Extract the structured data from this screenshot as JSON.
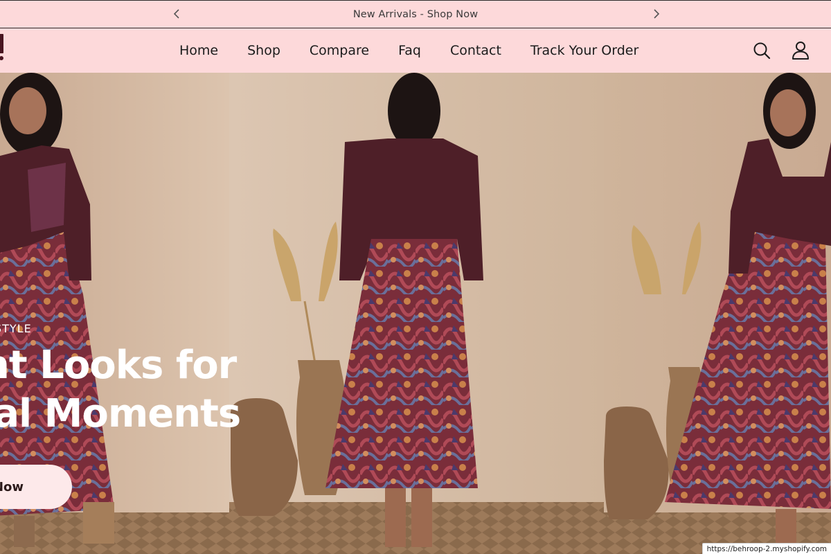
{
  "announcement": {
    "text": "New Arrivals - Shop Now",
    "prev_icon": "chevron-left-icon",
    "next_icon": "chevron-right-icon"
  },
  "header": {
    "nav": [
      {
        "label": "Home"
      },
      {
        "label": "Shop"
      },
      {
        "label": "Compare"
      },
      {
        "label": "Faq"
      },
      {
        "label": "Contact"
      },
      {
        "label": "Track Your Order"
      }
    ],
    "search_icon": "search-icon",
    "account_icon": "user-icon"
  },
  "hero": {
    "eyebrow": "STYLE",
    "line1": "nt Looks for",
    "line2": "ial Moments",
    "button_label": "Now",
    "images": [
      {
        "name": "model-front-left"
      },
      {
        "name": "model-back-center"
      },
      {
        "name": "model-front-right"
      }
    ]
  },
  "status_bar": {
    "url": "https://behroop-2.myshopify.com"
  },
  "colors": {
    "page_pink": "#fdd9da",
    "garment_plum": "#4e1f28",
    "wall_beige": "#d6bfa6",
    "hero_text": "#ffffff"
  }
}
